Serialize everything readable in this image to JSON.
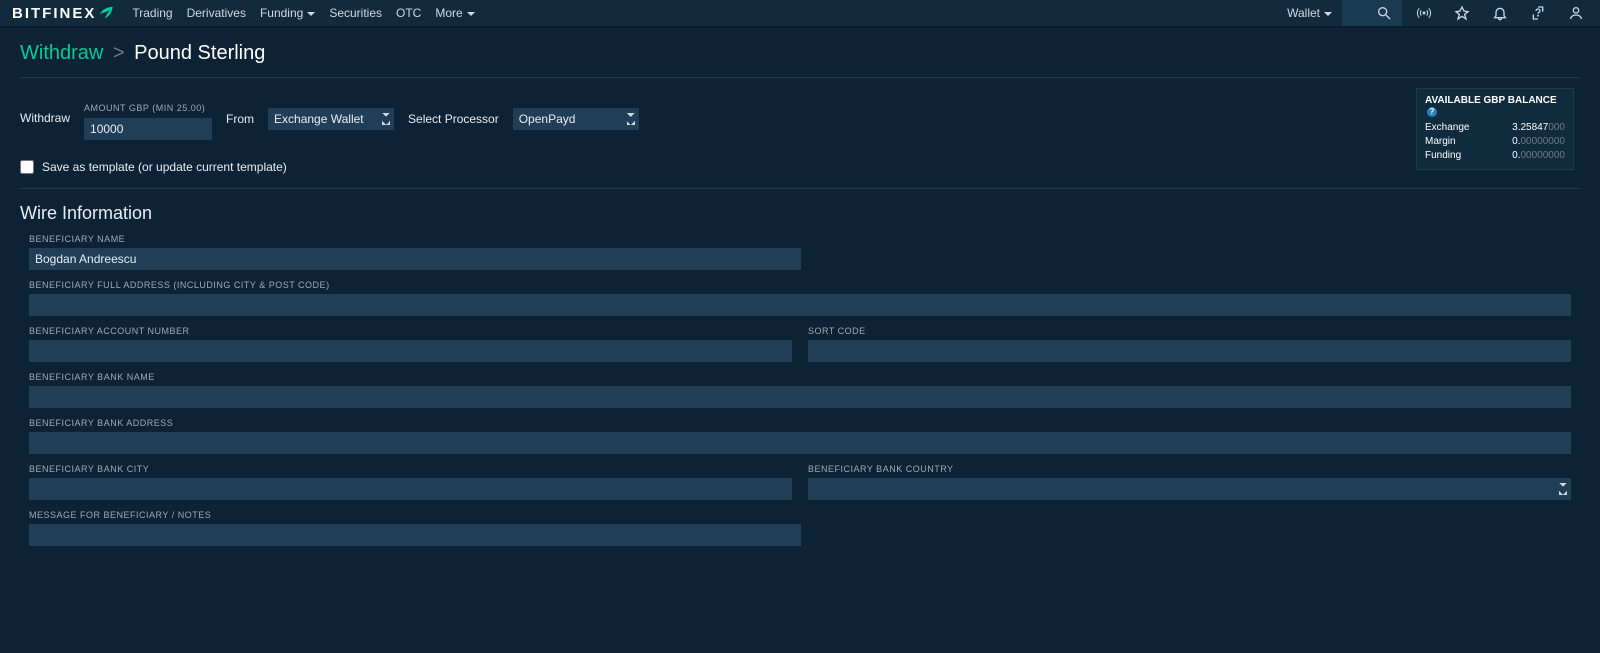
{
  "header": {
    "logo": "BITFINEX",
    "nav": {
      "trading": "Trading",
      "derivatives": "Derivatives",
      "funding": "Funding",
      "securities": "Securities",
      "otc": "OTC",
      "more": "More"
    },
    "wallet": "Wallet"
  },
  "breadcrumb": {
    "withdraw": "Withdraw",
    "separator": ">",
    "current": "Pound Sterling"
  },
  "controls": {
    "amount_label": "AMOUNT GBP (MIN 25.00)",
    "withdraw_label": "Withdraw",
    "amount_value": "10000",
    "from_label": "From",
    "from_value": "Exchange Wallet",
    "processor_label": "Select Processor",
    "processor_value": "OpenPayd",
    "template_label": "Save as template (or update current template)"
  },
  "balance": {
    "title": "AVAILABLE GBP BALANCE",
    "rows": {
      "exchange": {
        "label": "Exchange",
        "main": "3.25847",
        "dim": "000"
      },
      "margin": {
        "label": "Margin",
        "main": "0.",
        "dim": "00000000"
      },
      "funding": {
        "label": "Funding",
        "main": "0.",
        "dim": "00000000"
      }
    }
  },
  "wire": {
    "title": "Wire Information",
    "fields": {
      "ben_name": {
        "label": "BENEFICIARY NAME",
        "value": "Bogdan Andreescu"
      },
      "ben_addr": {
        "label": "BENEFICIARY FULL ADDRESS (INCLUDING CITY & POST CODE)",
        "value": ""
      },
      "ben_acct": {
        "label": "BENEFICIARY ACCOUNT NUMBER",
        "value": ""
      },
      "sort": {
        "label": "SORT CODE",
        "value": ""
      },
      "bank_name": {
        "label": "BENEFICIARY BANK NAME",
        "value": ""
      },
      "bank_addr": {
        "label": "BENEFICIARY BANK ADDRESS",
        "value": ""
      },
      "bank_city": {
        "label": "BENEFICIARY BANK CITY",
        "value": ""
      },
      "bank_ctry": {
        "label": "BENEFICIARY BANK COUNTRY",
        "value": ""
      },
      "notes": {
        "label": "MESSAGE FOR BENEFICIARY / NOTES",
        "value": ""
      }
    }
  }
}
